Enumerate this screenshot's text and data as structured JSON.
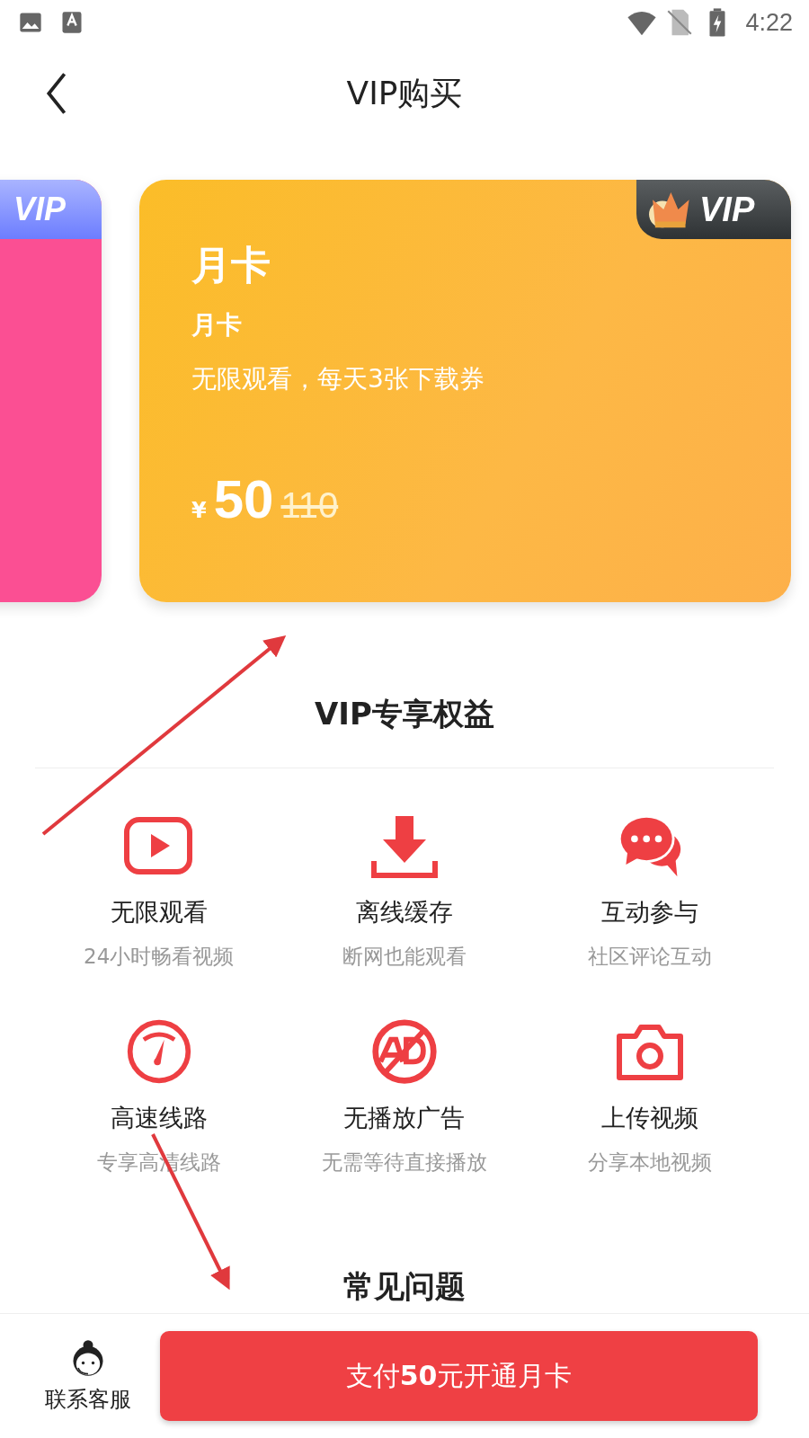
{
  "status_bar": {
    "time": "4:22"
  },
  "header": {
    "title": "VIP购买"
  },
  "cards": [
    {
      "kind": "pink",
      "badge": "VIP"
    },
    {
      "kind": "gold",
      "badge": "VIP",
      "name": "月卡",
      "subtitle": "月卡",
      "description": "无限观看，每天3张下载券",
      "currency": "¥",
      "price": "50",
      "original_price": "110"
    }
  ],
  "benefits_section": {
    "title": "VIP专享权益"
  },
  "benefits": [
    {
      "kind": "play",
      "title": "无限观看",
      "caption": "24小时畅看视频"
    },
    {
      "kind": "download",
      "title": "离线缓存",
      "caption": "断网也能观看"
    },
    {
      "kind": "chat",
      "title": "互动参与",
      "caption": "社区评论互动"
    },
    {
      "kind": "speed",
      "title": "高速线路",
      "caption": "专享高清线路"
    },
    {
      "kind": "noad",
      "title": "无播放广告",
      "caption": "无需等待直接播放"
    },
    {
      "kind": "camera",
      "title": "上传视频",
      "caption": "分享本地视频"
    }
  ],
  "faq_section": {
    "title": "常见问题"
  },
  "bottom_bar": {
    "support_label": "联系客服",
    "pay_button": "支付**50**元开通月卡"
  }
}
